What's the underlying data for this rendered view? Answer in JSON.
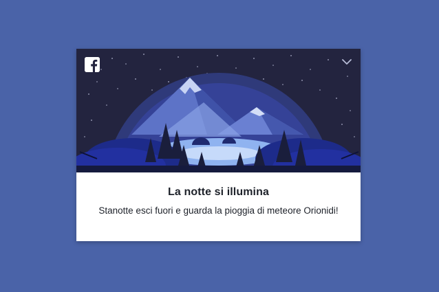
{
  "card": {
    "title": "La notte si illumina",
    "body": "Stanotte esci fuori e guarda la pioggia di meteore Orionidi!"
  },
  "icons": {
    "logo": "facebook-logo-icon",
    "menu": "chevron-down-icon"
  },
  "colors": {
    "page_background": "#4a63a8",
    "hero_sky": "#23243f",
    "card_background": "#ffffff",
    "text": "#1d2129"
  }
}
